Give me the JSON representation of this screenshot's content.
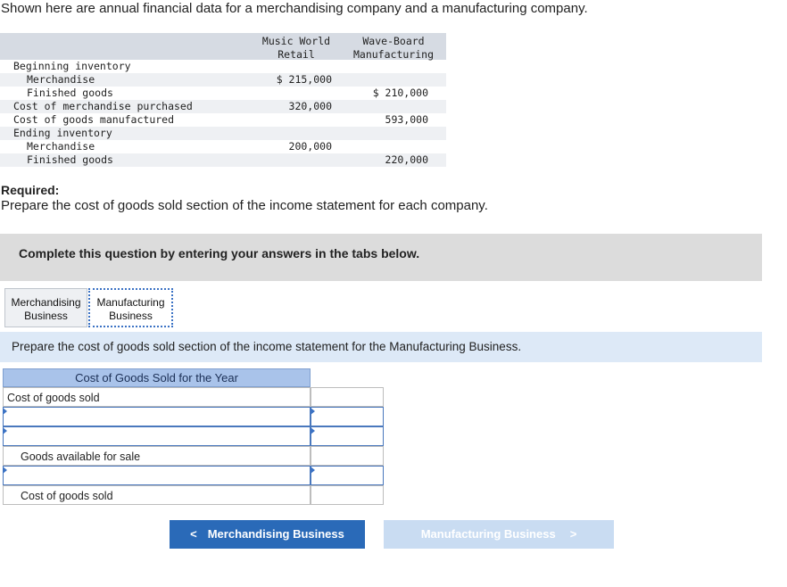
{
  "intro": "Shown here are annual financial data for a merchandising company and a manufacturing company.",
  "data_table": {
    "col1_line1": "Music World",
    "col1_line2": "Retail",
    "col2_line1": "Wave-Board",
    "col2_line2": "Manufacturing",
    "rows": [
      {
        "label": "Beginning inventory",
        "v1": "",
        "v2": ""
      },
      {
        "label": "Merchandise",
        "v1": "$ 215,000",
        "v2": ""
      },
      {
        "label": "Finished goods",
        "v1": "",
        "v2": "$ 210,000"
      },
      {
        "label": "Cost of merchandise purchased",
        "v1": "320,000",
        "v2": ""
      },
      {
        "label": "Cost of goods manufactured",
        "v1": "",
        "v2": "593,000"
      },
      {
        "label": "Ending inventory",
        "v1": "",
        "v2": ""
      },
      {
        "label": "Merchandise",
        "v1": "200,000",
        "v2": ""
      },
      {
        "label": "Finished goods",
        "v1": "",
        "v2": "220,000"
      }
    ]
  },
  "required": {
    "title": "Required:",
    "text": "Prepare the cost of goods sold section of the income statement for each company."
  },
  "banner": "Complete this question by entering your answers in the tabs below.",
  "tabs": {
    "tab1_line1": "Merchandising",
    "tab1_line2": "Business",
    "tab2_line1": "Manufacturing",
    "tab2_line2": "Business"
  },
  "instruction": "Prepare the cost of goods sold section of the income statement for the Manufacturing Business.",
  "work_table": {
    "header": "Cost of Goods Sold for the Year",
    "row1_label": "Cost of goods sold",
    "row4_label": "Goods available for sale",
    "row6_label": "Cost of goods sold",
    "input1": "",
    "input2": "",
    "input3": "",
    "input4": "",
    "input5": "",
    "input6": ""
  },
  "nav": {
    "prev_arrow": "<",
    "prev_label": "Merchandising Business",
    "next_label": "Manufacturing Business",
    "next_arrow": ">"
  }
}
